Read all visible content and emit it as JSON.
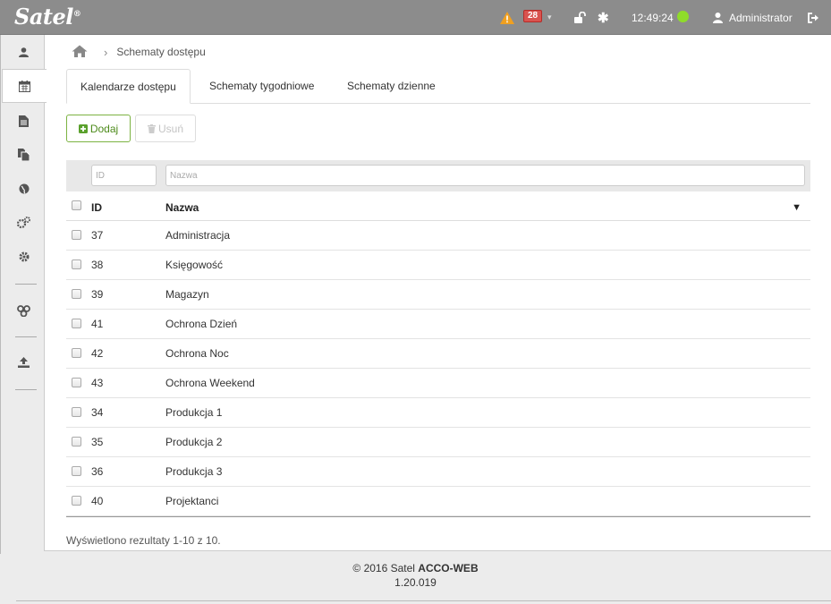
{
  "app": {
    "logo_text": "Satel",
    "logo_mark": "®"
  },
  "topbar": {
    "alarm_count": "28",
    "caret": "▾",
    "asterisk": "✱",
    "clock": "12:49:24",
    "user_name": "Administrator",
    "status_color": "#8fdc2a",
    "badge_color": "#d9534f"
  },
  "sidebar": {
    "items": [
      {
        "icon": "user-icon"
      },
      {
        "icon": "calendar-icon",
        "active": true
      },
      {
        "icon": "document-icon"
      },
      {
        "icon": "documents-icon"
      },
      {
        "icon": "globe-icon"
      },
      {
        "icon": "gears-icon"
      },
      {
        "icon": "gear-icon"
      },
      {
        "icon": "network-icon"
      },
      {
        "icon": "upload-icon"
      }
    ]
  },
  "breadcrumb": {
    "separator": "›",
    "current": "Schematy dostępu"
  },
  "tabs": [
    {
      "label": "Kalendarze dostępu",
      "active": true
    },
    {
      "label": "Schematy tygodniowe",
      "active": false
    },
    {
      "label": "Schematy dzienne",
      "active": false
    }
  ],
  "toolbar": {
    "add_label": "Dodaj",
    "delete_label": "Usuń"
  },
  "filters": {
    "id_placeholder": "ID",
    "name_placeholder": "Nazwa"
  },
  "table": {
    "columns": {
      "id": "ID",
      "name": "Nazwa"
    },
    "sort_indicator": "▼",
    "rows": [
      {
        "id": "37",
        "name": "Administracja"
      },
      {
        "id": "38",
        "name": "Księgowość"
      },
      {
        "id": "39",
        "name": "Magazyn"
      },
      {
        "id": "41",
        "name": "Ochrona Dzień"
      },
      {
        "id": "42",
        "name": "Ochrona Noc"
      },
      {
        "id": "43",
        "name": "Ochrona Weekend"
      },
      {
        "id": "34",
        "name": "Produkcja 1"
      },
      {
        "id": "35",
        "name": "Produkcja 2"
      },
      {
        "id": "36",
        "name": "Produkcja 3"
      },
      {
        "id": "40",
        "name": "Projektanci"
      }
    ]
  },
  "results_text": "Wyświetlono rezultaty 1-10 z 10.",
  "footer": {
    "copyright": "© 2016 Satel ",
    "product": "ACCO-WEB",
    "version": "1.20.019"
  }
}
